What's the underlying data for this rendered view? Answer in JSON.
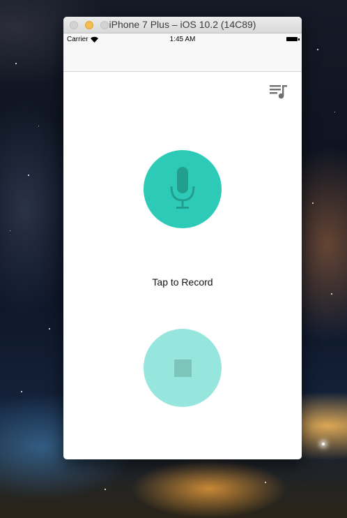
{
  "window": {
    "title": "iPhone 7 Plus – iOS 10.2 (14C89)"
  },
  "status_bar": {
    "carrier": "Carrier",
    "time": "1:45 AM"
  },
  "toolbar": {
    "playlist_icon": "playlist-music-icon"
  },
  "recorder": {
    "record_icon": "microphone-icon",
    "label": "Tap to Record",
    "stop_icon": "stop-icon"
  },
  "colors": {
    "accent": "#2dcbb7",
    "accent_disabled": "#96e6dd"
  }
}
